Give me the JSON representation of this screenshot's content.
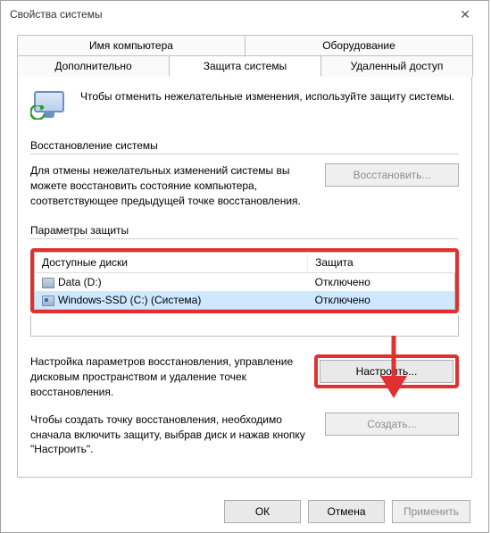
{
  "window": {
    "title": "Свойства системы",
    "close": "✕"
  },
  "tabs": {
    "row1": [
      "Имя компьютера",
      "Оборудование"
    ],
    "row2": [
      "Дополнительно",
      "Защита системы",
      "Удаленный доступ"
    ],
    "active": "Защита системы"
  },
  "intro": "Чтобы отменить нежелательные изменения, используйте защиту системы.",
  "restore": {
    "title": "Восстановление системы",
    "text": "Для отмены нежелательных изменений системы вы можете восстановить состояние компьютера, соответствующее предыдущей точке восстановления.",
    "button": "Восстановить..."
  },
  "protection": {
    "title": "Параметры защиты",
    "headers": {
      "drive": "Доступные диски",
      "status": "Защита"
    },
    "rows": [
      {
        "icon": "drive",
        "name": "Data (D:)",
        "status": "Отключено",
        "selected": false
      },
      {
        "icon": "drive-win",
        "name": "Windows-SSD (C:) (Система)",
        "status": "Отключено",
        "selected": true
      }
    ]
  },
  "configure": {
    "text": "Настройка параметров восстановления, управление дисковым пространством и удаление точек восстановления.",
    "button": "Настроить..."
  },
  "create": {
    "text": "Чтобы создать точку восстановления, необходимо сначала включить защиту, выбрав диск и нажав кнопку \"Настроить\".",
    "button": "Создать..."
  },
  "footer": {
    "ok": "ОК",
    "cancel": "Отмена",
    "apply": "Применить"
  }
}
